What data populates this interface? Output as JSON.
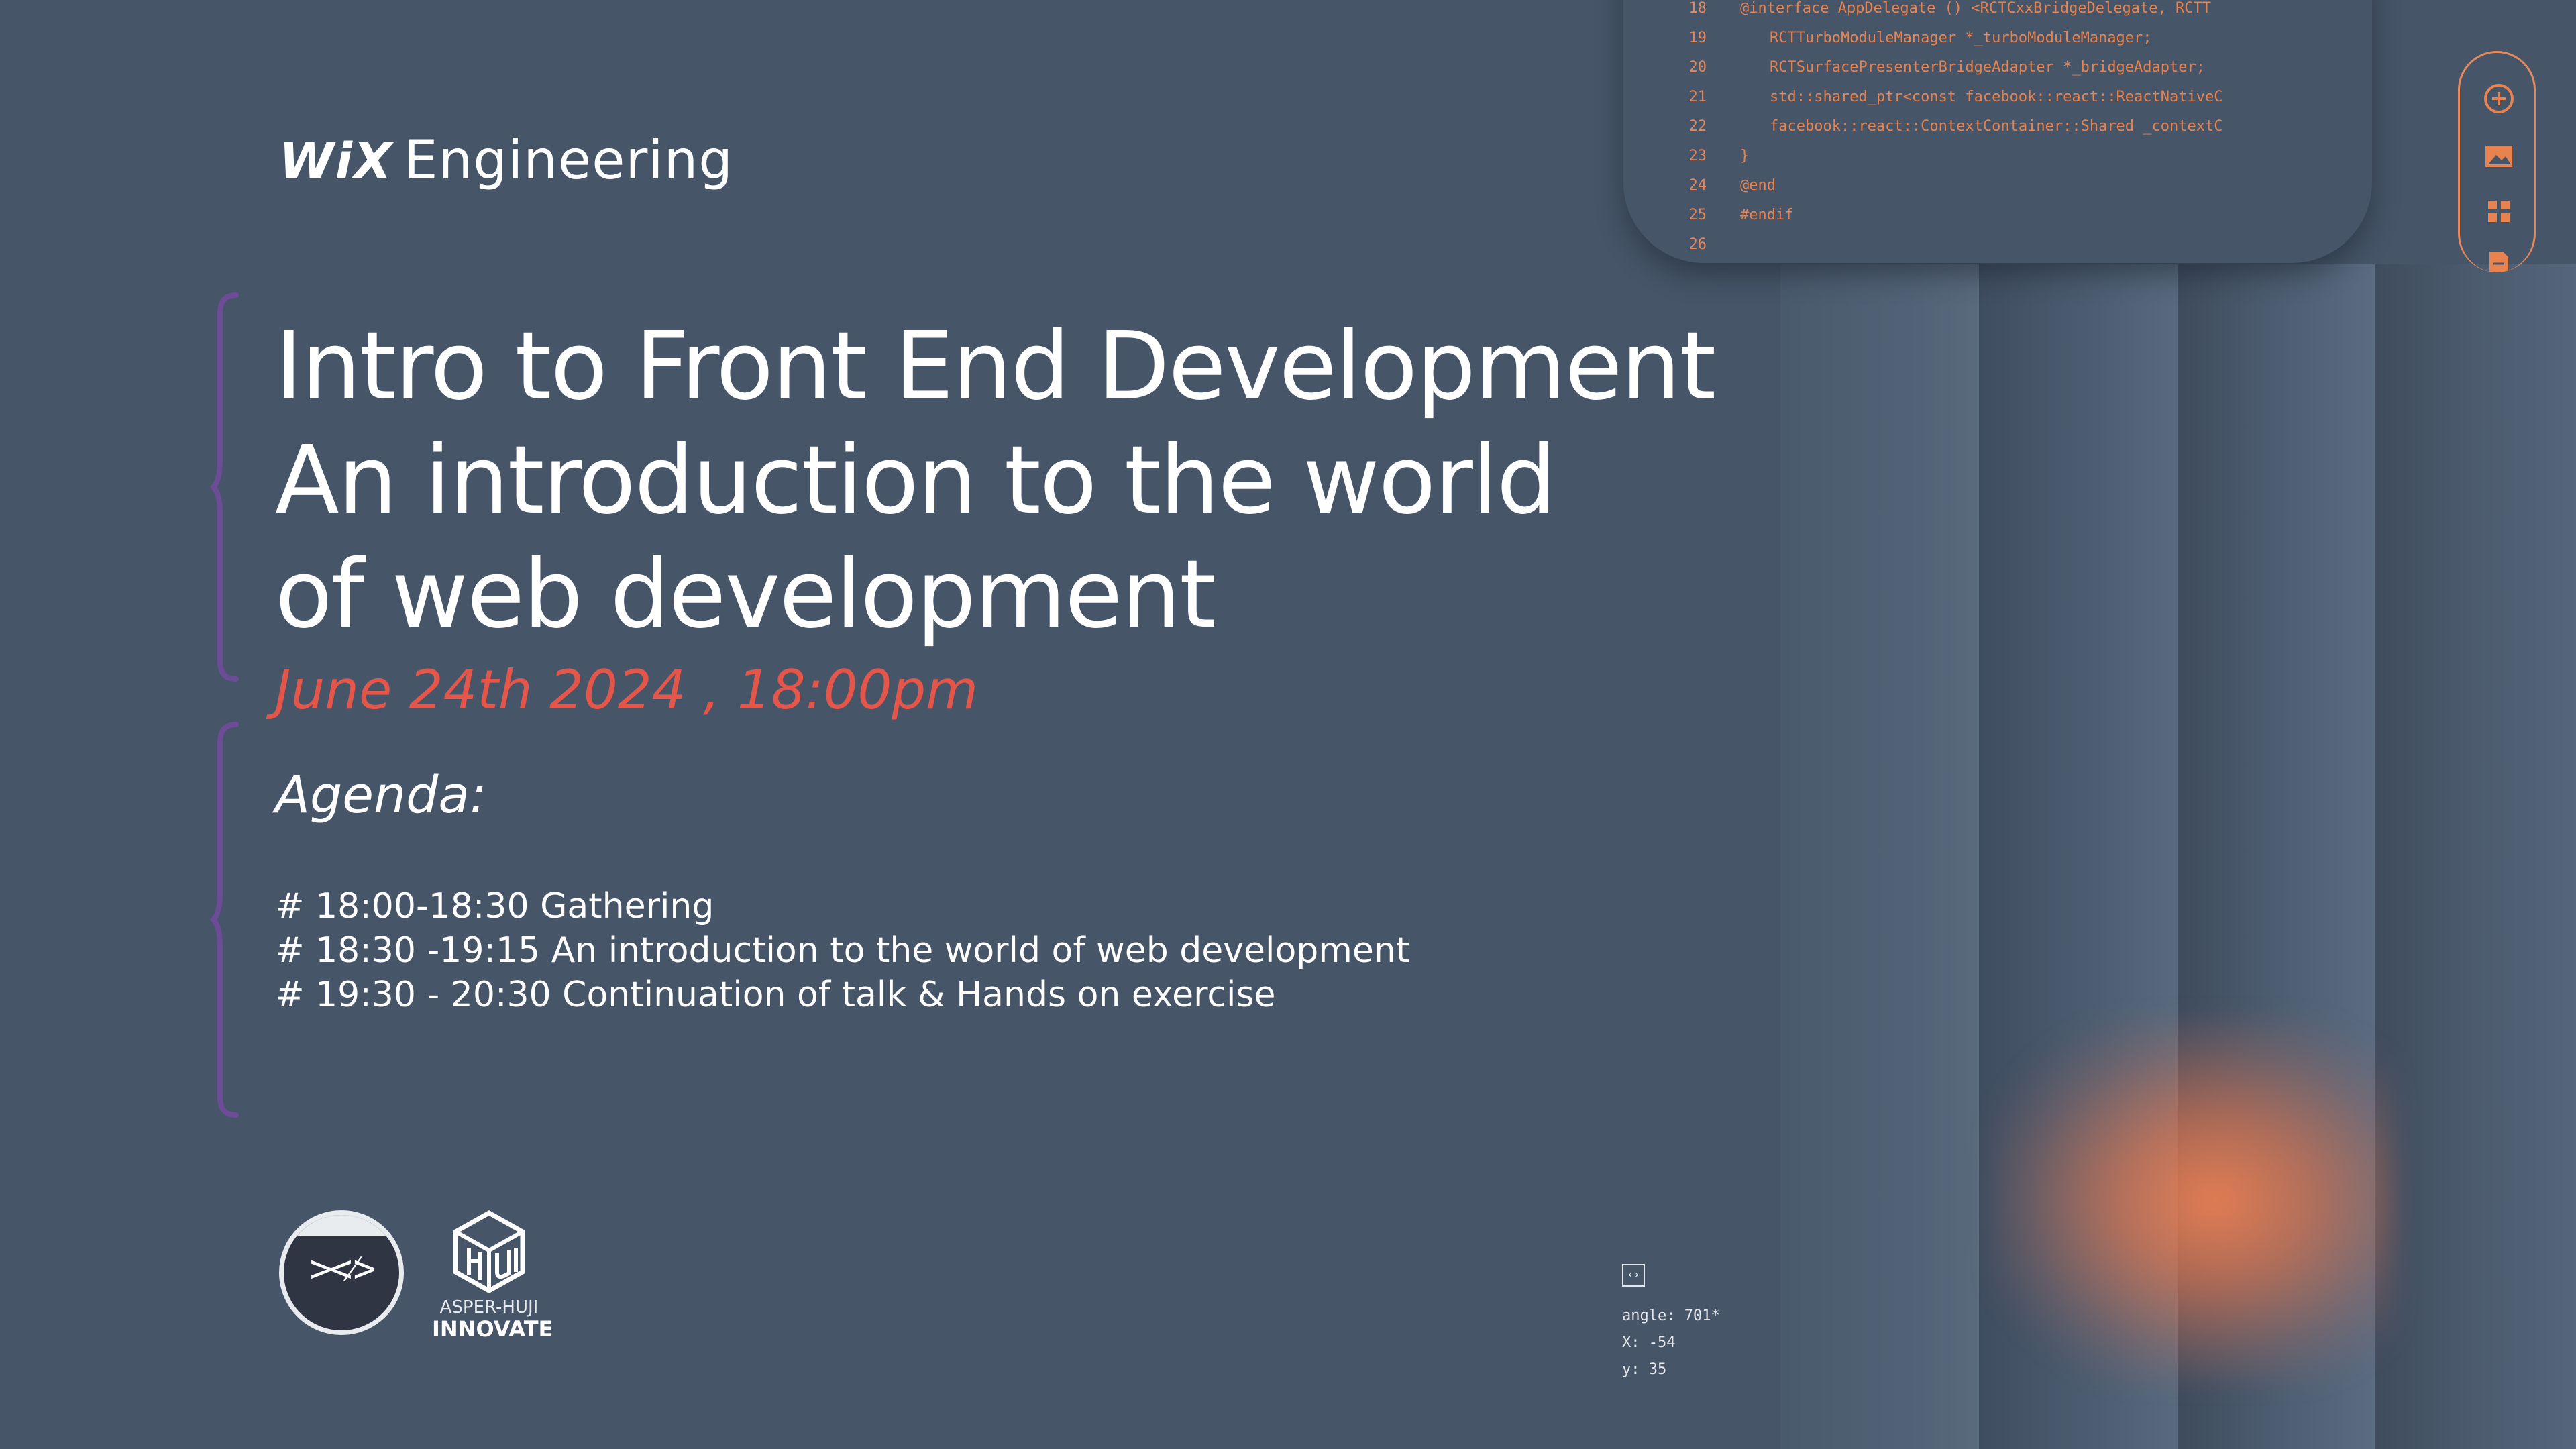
{
  "brand": {
    "wix": "WiX",
    "engineering": "Engineering"
  },
  "event": {
    "title_lines": [
      "Intro to Front End Development",
      "An introduction to the world",
      "of web development"
    ],
    "date": "June 24th 2024 , 18:00pm",
    "agenda_heading": "Agenda:",
    "agenda_items": [
      "# 18:00-18:30 Gathering",
      "# 18:30 -19:15 An introduction to the world of web development",
      "# 19:30 - 20:30 Continuation of talk & Hands on exercise"
    ]
  },
  "logos": {
    "code_symbol": "><⁄>",
    "huji_top": "ASPER-HUJI",
    "huji_bottom": "INNOVATE"
  },
  "code_editor": {
    "lines": [
      {
        "n": "18",
        "text": "@interface AppDelegate () <RCTCxxBridgeDelegate, RCTT"
      },
      {
        "n": "19",
        "text": "  RCTTurboModuleManager *_turboModuleManager;"
      },
      {
        "n": "20",
        "text": "  RCTSurfacePresenterBridgeAdapter *_bridgeAdapter;"
      },
      {
        "n": "21",
        "text": "  std::shared_ptr<const facebook::react::ReactNativeC"
      },
      {
        "n": "22",
        "text": "  facebook::react::ContextContainer::Shared _contextC"
      },
      {
        "n": "23",
        "text": "}"
      },
      {
        "n": "24",
        "text": "@end"
      },
      {
        "n": "25",
        "text": "#endif"
      },
      {
        "n": "26",
        "text": ""
      }
    ]
  },
  "toolbar_icons": [
    "plus-circle-icon",
    "image-icon",
    "grid-icon",
    "document-icon"
  ],
  "coords": {
    "tag": "‹›",
    "angle": "angle: 701*",
    "x": "X: -54",
    "y": "y: 35"
  },
  "colors": {
    "background": "#465568",
    "accent": "#e5564a",
    "code": "#e8834f",
    "brace": "#6c4c96"
  }
}
